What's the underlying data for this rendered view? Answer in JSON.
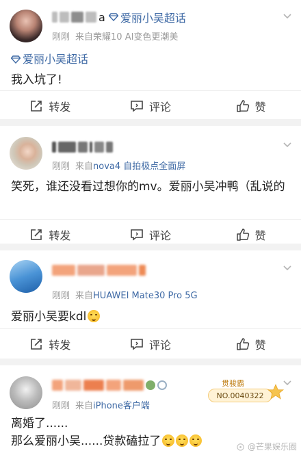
{
  "posts": [
    {
      "name_suffix": "a",
      "super_topic_badge": "爱丽小吴超话",
      "time": "刚刚",
      "source_prefix": "来自",
      "device": "荣耀10 AI变色更潮美",
      "topic": "爱丽小吴超话",
      "text": "我入坑了!"
    },
    {
      "time": "刚刚",
      "source_prefix": "来自",
      "device": "nova4 自拍极点全面屏",
      "text": "笑死，谁还没看过想你的mv。爱丽小吴冲鸭（乱说的"
    },
    {
      "time": "刚刚",
      "source_prefix": "来自",
      "device": "HUAWEI Mate30 Pro 5G",
      "text": "爱丽小吴要kdl"
    },
    {
      "time": "刚刚",
      "source_prefix": "来自",
      "device": "iPhone客户端",
      "text_line1": "离婚了......",
      "text_line2": "那么爱丽小吴......贷款磕拉了",
      "badge_label": "贯骏霸",
      "badge_number": "NO.0040322"
    }
  ],
  "toolbar": {
    "repost_label": "转发",
    "comment_label": "评论",
    "like_label": "赞"
  },
  "watermark": "@芒果娱乐圈",
  "colors": {
    "link": "#3f6aa5",
    "meta": "#9b9b9b",
    "separator": "#f2f2f2"
  }
}
